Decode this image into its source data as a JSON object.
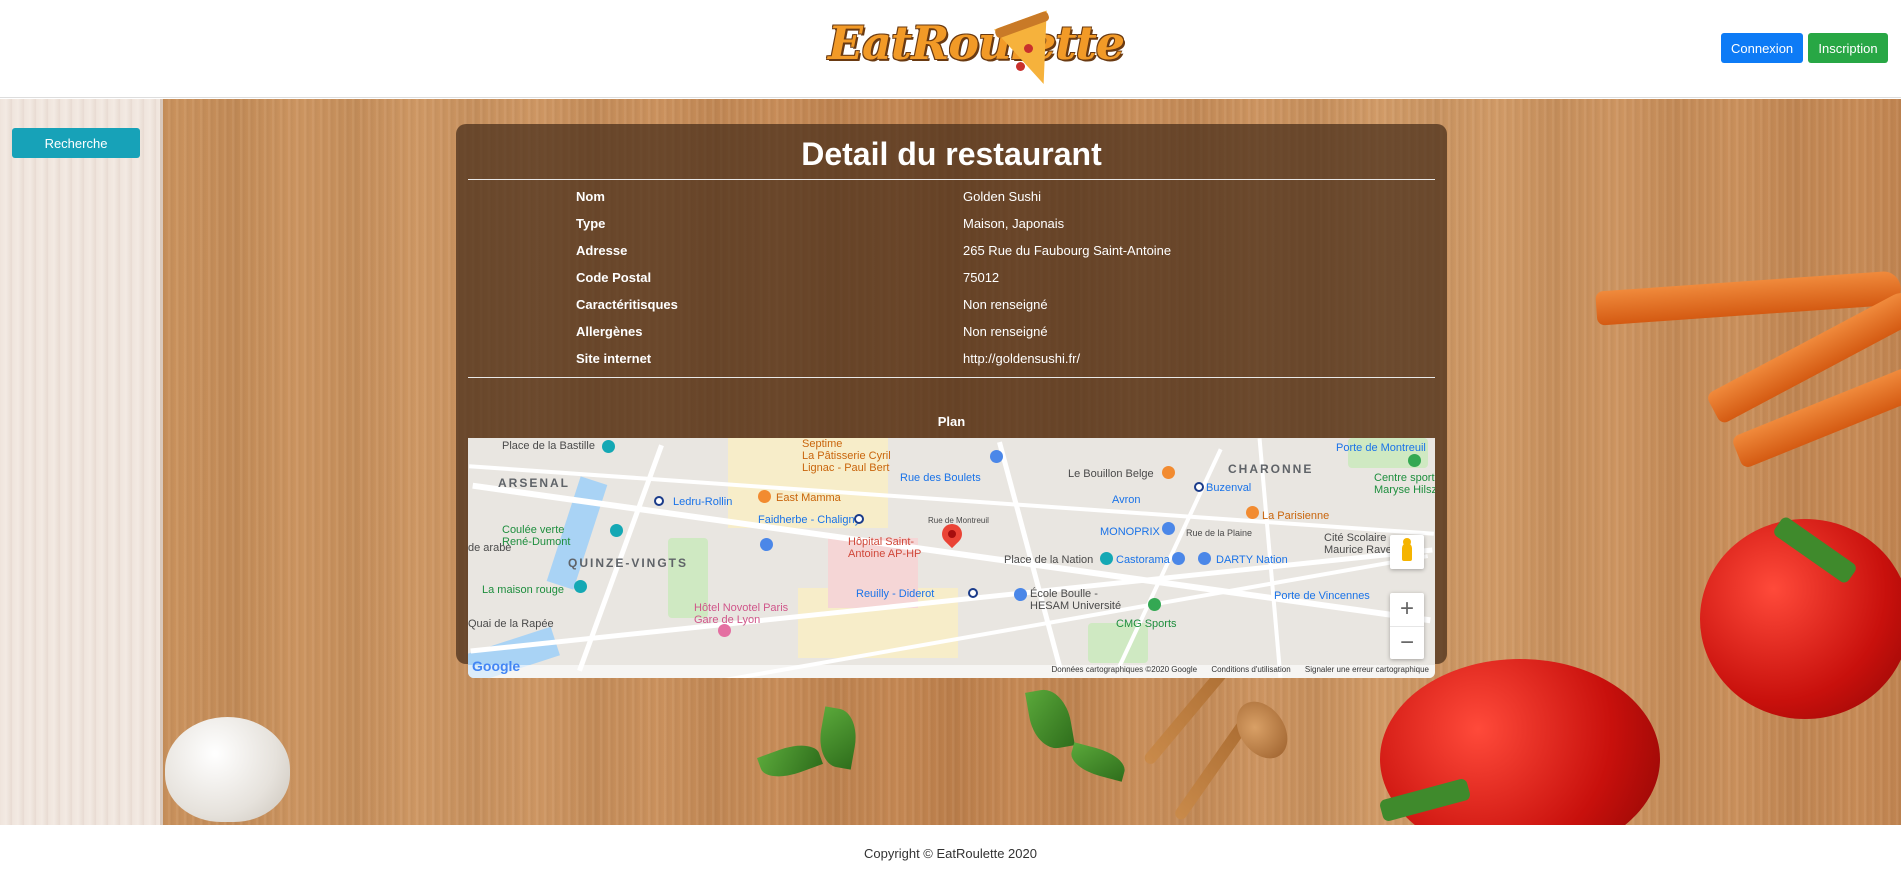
{
  "header": {
    "logo_text": "EatRoulette",
    "connexion_label": "Connexion",
    "inscription_label": "Inscription"
  },
  "sidebar": {
    "search_label": "Recherche"
  },
  "detail": {
    "title": "Detail du restaurant",
    "rows": [
      {
        "label": "Nom",
        "value": "Golden Sushi"
      },
      {
        "label": "Type",
        "value": "Maison, Japonais"
      },
      {
        "label": "Adresse",
        "value": "265 Rue du Faubourg Saint-Antoine"
      },
      {
        "label": "Code Postal",
        "value": "75012"
      },
      {
        "label": "Caractéritisques",
        "value": "Non renseigné"
      },
      {
        "label": "Allergènes",
        "value": "Non renseigné"
      },
      {
        "label": "Site internet",
        "value": "http://goldensushi.fr/"
      }
    ],
    "plan_label": "Plan"
  },
  "map": {
    "labels": {
      "place_bastille": "Place de la Bastille",
      "patisserie": "La Pâtisserie Cyril Lignac - Paul Bert",
      "septime": "Septime",
      "porte_montreuil": "Porte de Montreuil",
      "charonne": "CHARONNE",
      "arsenal": "ARSENAL",
      "rue_boulets": "Rue des Boulets",
      "bouillon": "Le Bouillon Belge",
      "buzenval": "Buzenval",
      "centre_sportif": "Centre sportif Maryse Hilsz",
      "ledru": "Ledru-Rollin",
      "east_mamma": "East Mamma",
      "avron": "Avron",
      "parisienne": "La Parisienne",
      "faidherbe": "Faidherbe - Chaligny",
      "hopital": "Hôpital Saint-Antoine AP-HP",
      "monoprix": "MONOPRIX",
      "rue_plaine": "Rue de la Plaine",
      "cite_scolaire": "Cité Scolaire Maurice Ravel",
      "coulee": "Coulée verte René-Dumont",
      "arabe": "de arabe",
      "quinze": "QUINZE-VINGTS",
      "place_nation": "Place de la Nation",
      "castorama": "Castorama",
      "darty": "DARTY Nation",
      "maison_rouge": "La maison rouge",
      "reuilly": "Reuilly - Diderot",
      "ecole_boulle": "École Boulle - HESAM Université",
      "porte_vincennes": "Porte de Vincennes",
      "novotel": "Hôtel Novotel Paris Gare de Lyon",
      "cmg": "CMG Sports",
      "quai_rapee": "Quai de la Rapée",
      "rue_montreuil": "Rue de Montreuil"
    },
    "google": "Google",
    "footer": {
      "data": "Données cartographiques ©2020 Google",
      "terms": "Conditions d'utilisation",
      "report": "Signaler une erreur cartographique"
    },
    "zoom_in": "+",
    "zoom_out": "−"
  },
  "footer": {
    "copyright": "Copyright © EatRoulette 2020"
  }
}
